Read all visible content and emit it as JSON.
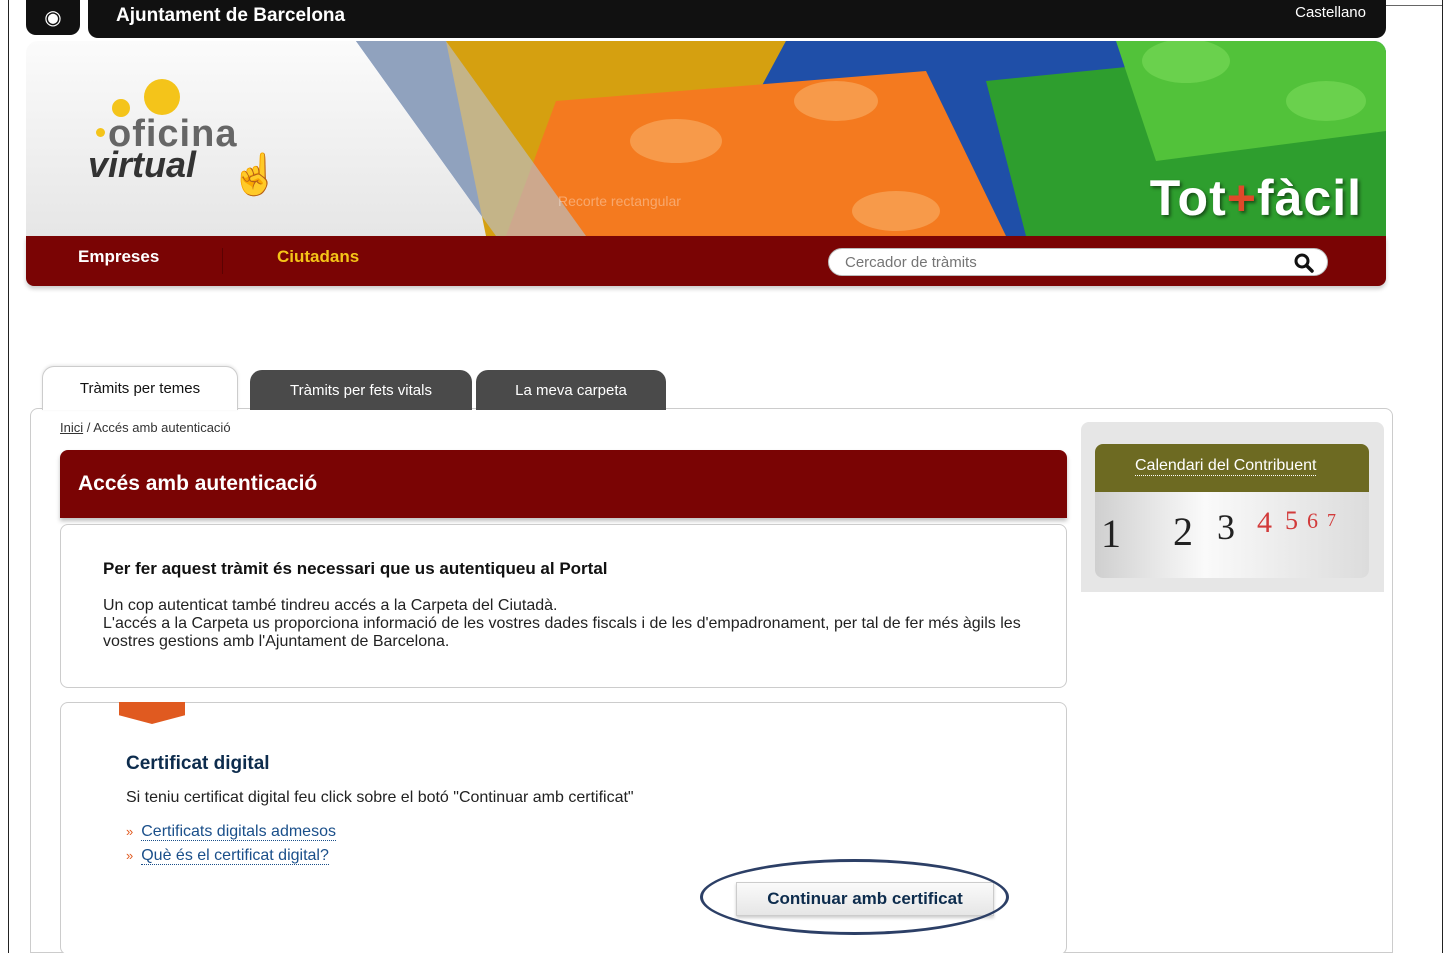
{
  "header": {
    "org_name": "Ajuntament de Barcelona",
    "language_link": "Castellano"
  },
  "banner": {
    "brand_line1": "oficina",
    "brand_line2": "virtual",
    "slogan_part1": "Tot",
    "slogan_plus": "+",
    "slogan_part2": "fàcil",
    "watermark": "Recorte rectangular"
  },
  "nav": {
    "items": [
      {
        "label": "Empreses"
      },
      {
        "label": "Ciutadans"
      }
    ],
    "search_placeholder": "Cercador de tràmits"
  },
  "tabs": [
    {
      "label": "Tràmits per temes",
      "active": true
    },
    {
      "label": "Tràmits per fets vitals",
      "active": false
    },
    {
      "label": "La meva carpeta",
      "active": false
    }
  ],
  "breadcrumb": {
    "home": "Inici",
    "separator": " / ",
    "current": "Accés amb autenticació"
  },
  "main": {
    "title": "Accés amb autenticació",
    "info_heading": "Per fer aquest tràmit és necessari que us autentiqueu al Portal",
    "info_line1": "Un cop autenticat també tindreu accés a la Carpeta del Ciutadà.",
    "info_line2": "L'accés a la Carpeta us proporciona informació de les vostres dades fiscals i de les d'empadronament, per tal de fer més àgils les vostres gestions amb l'Ajuntament de Barcelona.",
    "cert_heading": "Certificat digital",
    "cert_description": "Si teniu certificat digital feu click sobre el botó \"Continuar amb certificat\"",
    "links": [
      {
        "label": "Certificats digitals admesos"
      },
      {
        "label": "Què és el certificat digital?"
      }
    ],
    "continue_button": "Continuar amb certificat"
  },
  "sidebar": {
    "calendar_title": "Calendari del Contribuent",
    "calendar_numbers": [
      "1",
      "2",
      "3",
      "4",
      "5",
      "6",
      "7"
    ]
  },
  "colors": {
    "brand_red": "#7a0404",
    "accent_yellow": "#f5c518",
    "link_blue": "#1a4f8a",
    "accent_orange": "#e05a20",
    "calendar_olive": "#6d6a22"
  }
}
